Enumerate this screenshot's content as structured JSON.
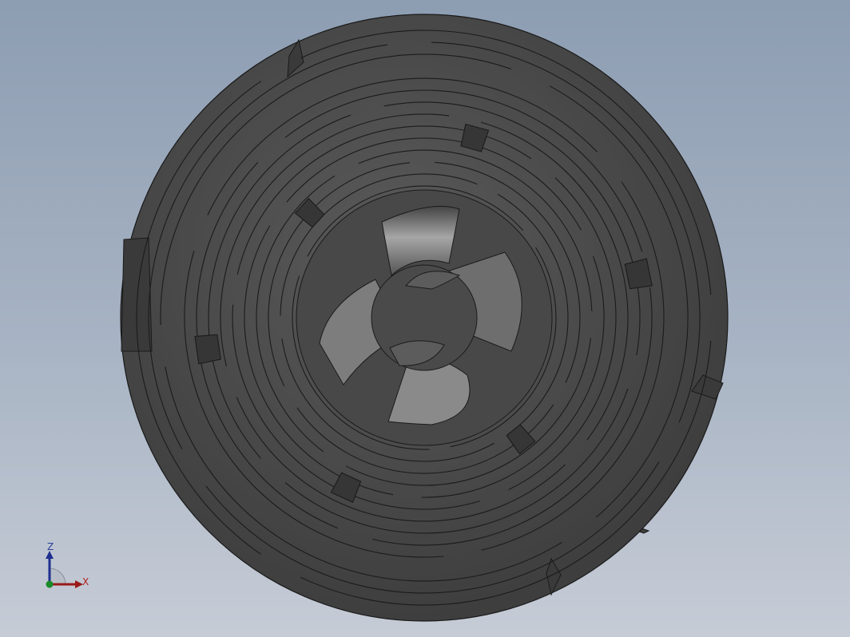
{
  "viewport": {
    "background_top": "#8d9db2",
    "background_bottom": "#c6ccd6"
  },
  "model": {
    "body_color": "#4a4a4a",
    "edge_color": "#1a1a1a",
    "highlight_color": "#bdbdbd"
  },
  "triad": {
    "z_label": "Z",
    "x_label": "X",
    "z_color": "#1f2f8f",
    "x_color": "#9a1a1a",
    "y_color": "#1c8a2a"
  }
}
